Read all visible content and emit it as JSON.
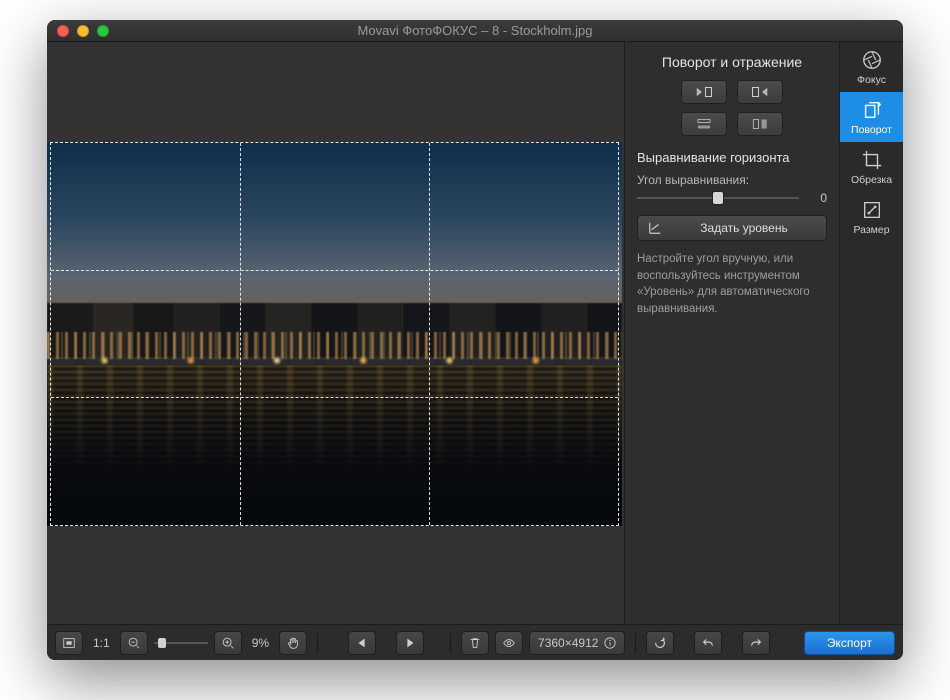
{
  "window": {
    "title": "Movavi ФотоФОКУС – 8 - Stockholm.jpg"
  },
  "panel": {
    "section1_title": "Поворот и отражение",
    "section2_title": "Выравнивание горизонта",
    "angle_label": "Угол выравнивания:",
    "angle_value": "0",
    "level_button": "Задать уровень",
    "hint": "Настройте угол вручную, или воспользуйтесь инструментом «Уровень» для автоматического выравнивания."
  },
  "sidebar": {
    "tools": [
      {
        "label": "Фокус"
      },
      {
        "label": "Поворот"
      },
      {
        "label": "Обрезка"
      },
      {
        "label": "Размер"
      }
    ],
    "active_index": 1
  },
  "bottombar": {
    "fit_label": "1:1",
    "zoom_percent": "9%",
    "dimensions": "7360×4912",
    "export_label": "Экспорт"
  }
}
